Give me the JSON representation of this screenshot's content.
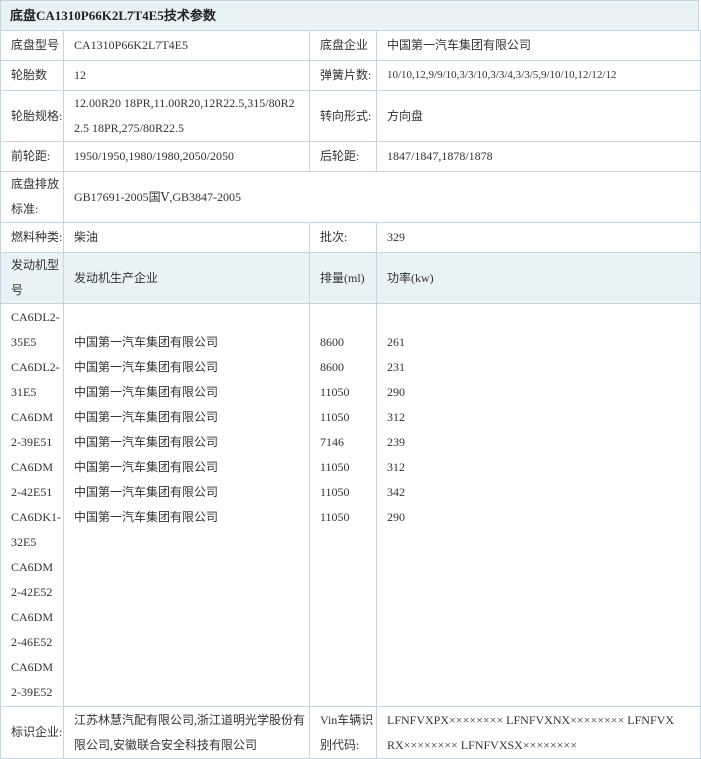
{
  "title": "底盘CA1310P66K2L7T4E5技术参数",
  "rows": {
    "chassis_model_label": "底盘型号",
    "chassis_model": "CA1310P66K2L7T4E5",
    "chassis_company_label": "底盘企业",
    "chassis_company": "中国第一汽车集团有限公司",
    "tire_count_label": "轮胎数",
    "tire_count": "12",
    "spring_label": "弹簧片数:",
    "spring": "10/10,12,9/9/10,3/3/10,3/3/4,3/3/5,9/10/10,12/12/12",
    "tire_spec_label": "轮胎规格:",
    "tire_spec_line1": "12.00R20 18PR,11.00R20,12R22.5,315/80R2",
    "tire_spec_line2": "2.5 18PR,275/80R22.5",
    "steering_label": "转向形式:",
    "steering": "方向盘",
    "front_track_label": "前轮距:",
    "front_track": "1950/1950,1980/1980,2050/2050",
    "rear_track_label": "后轮距:",
    "rear_track": "1847/1847,1878/1878",
    "emission_label_line1": "底盘排放",
    "emission_label_line2": "标准:",
    "emission": "GB17691-2005国Ⅴ,GB3847-2005",
    "fuel_label": "燃料种类:",
    "fuel": "柴油",
    "batch_label": "批次:",
    "batch": "329"
  },
  "engine_header": {
    "model_line1": "发动机型",
    "model_line2": "号",
    "maker": "发动机生产企业",
    "displacement": "排量(ml)",
    "power": "功率(kw)"
  },
  "engine_models": [
    "CA6DL2-",
    "35E5",
    "CA6DL2-",
    "31E5",
    "CA6DM",
    "2-39E51",
    "CA6DM",
    "2-42E51",
    "CA6DK1-",
    "32E5",
    "CA6DM",
    "2-42E52",
    "CA6DM",
    "2-46E52",
    "CA6DM",
    "2-39E52"
  ],
  "engines": [
    {
      "maker": "中国第一汽车集团有限公司",
      "displacement": "8600",
      "power": "261"
    },
    {
      "maker": "中国第一汽车集团有限公司",
      "displacement": "8600",
      "power": "231"
    },
    {
      "maker": "中国第一汽车集团有限公司",
      "displacement": "11050",
      "power": "290"
    },
    {
      "maker": "中国第一汽车集团有限公司",
      "displacement": "11050",
      "power": "312"
    },
    {
      "maker": "中国第一汽车集团有限公司",
      "displacement": "7146",
      "power": "239"
    },
    {
      "maker": "中国第一汽车集团有限公司",
      "displacement": "11050",
      "power": "312"
    },
    {
      "maker": "中国第一汽车集团有限公司",
      "displacement": "11050",
      "power": "342"
    },
    {
      "maker": "中国第一汽车集团有限公司",
      "displacement": "11050",
      "power": "290"
    }
  ],
  "footer": {
    "id_company_label": "标识企业:",
    "id_company_line1": "江苏林慧汽配有限公司,浙江道明光学股份有",
    "id_company_line2": "限公司,安徽联合安全科技有限公司",
    "vin_label_line1": "Vin车辆识",
    "vin_label_line2": "别代码:",
    "vin_line1": "LFNFVXPX×××××××× LFNFVXNX×××××××× LFNFVX",
    "vin_line2": "RX×××××××× LFNFVXSX××××××××"
  }
}
